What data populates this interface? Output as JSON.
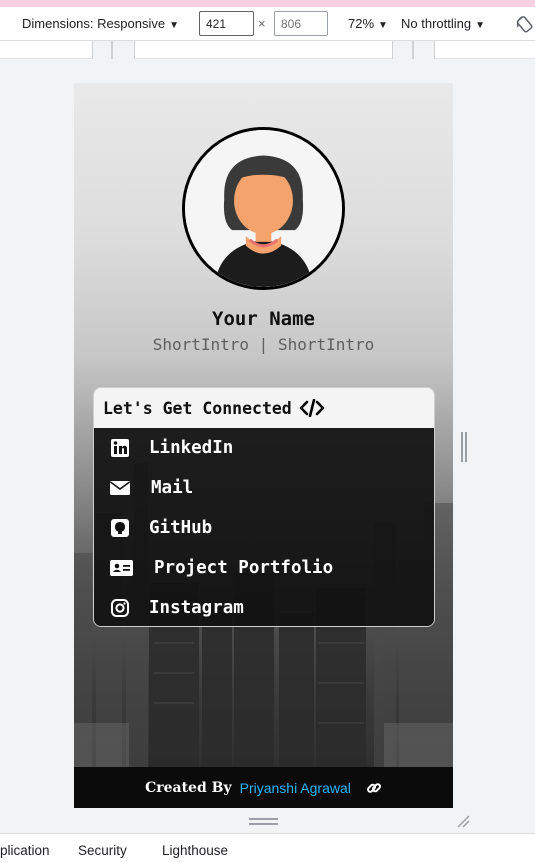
{
  "toolbar": {
    "dimensions_label": "Dimensions: Responsive",
    "width_value": "421",
    "times_symbol": "×",
    "height_value": "806",
    "zoom": "72%",
    "throttling": "No throttling",
    "caret": "▼"
  },
  "profile": {
    "name": "Your Name",
    "intro": "ShortIntro | ShortIntro",
    "avatar_icon": "avatar-woman-icon"
  },
  "card": {
    "title": "Let's Get Connected",
    "title_icon": "code-icon",
    "links": [
      {
        "label": "LinkedIn",
        "icon": "linkedin-icon"
      },
      {
        "label": "Mail",
        "icon": "mail-icon"
      },
      {
        "label": "GitHub",
        "icon": "github-icon"
      },
      {
        "label": "Project Portfolio",
        "icon": "id-card-icon"
      },
      {
        "label": "Instagram",
        "icon": "instagram-icon"
      }
    ]
  },
  "footer": {
    "created_by": "Created By",
    "author": "Priyanshi Agrawal",
    "link_icon": "link-icon"
  },
  "devtools_tabs": [
    "plication",
    "Security",
    "Lighthouse"
  ],
  "colors": {
    "accent": "#29b6f6",
    "card_body": "#111111",
    "footer": "#0b0b0b",
    "skin": "#f4a36d",
    "hair": "#3a3a3a"
  }
}
